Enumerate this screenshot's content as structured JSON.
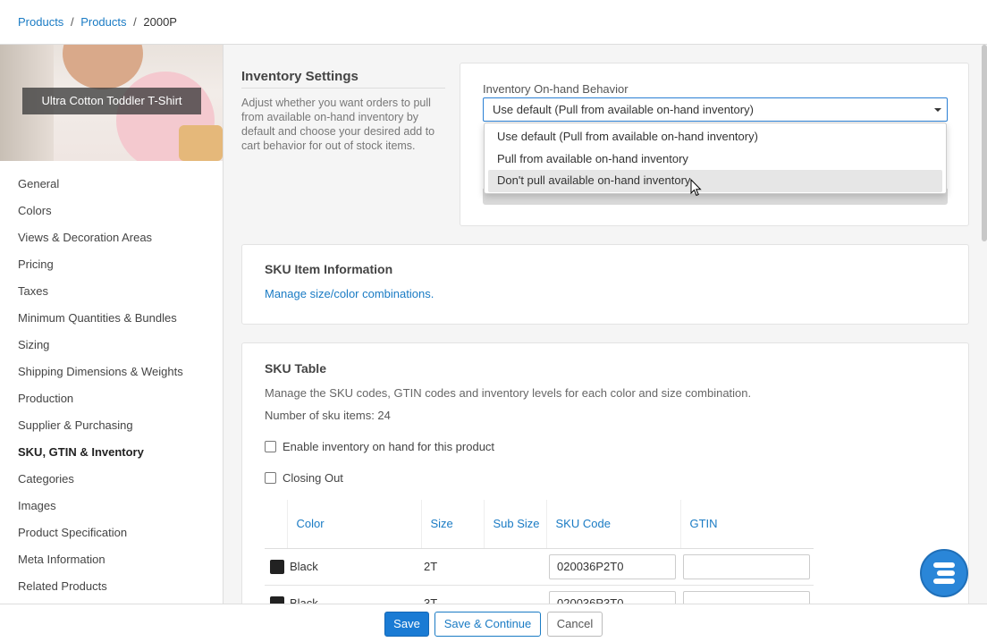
{
  "breadcrumb": {
    "items": [
      "Products",
      "Products"
    ],
    "separator": "/",
    "current": "2000P"
  },
  "sidebar": {
    "product_name": "Ultra Cotton Toddler T-Shirt",
    "items": [
      {
        "label": "General"
      },
      {
        "label": "Colors"
      },
      {
        "label": "Views & Decoration Areas"
      },
      {
        "label": "Pricing"
      },
      {
        "label": "Taxes"
      },
      {
        "label": "Minimum Quantities & Bundles"
      },
      {
        "label": "Sizing"
      },
      {
        "label": "Shipping Dimensions & Weights"
      },
      {
        "label": "Production"
      },
      {
        "label": "Supplier & Purchasing"
      },
      {
        "label": "SKU, GTIN & Inventory",
        "active": true
      },
      {
        "label": "Categories"
      },
      {
        "label": "Images"
      },
      {
        "label": "Product Specification"
      },
      {
        "label": "Meta Information"
      },
      {
        "label": "Related Products"
      }
    ]
  },
  "inventory": {
    "title": "Inventory Settings",
    "description": "Adjust whether you want orders to pull from available on-hand inventory by default and choose your desired add to cart behavior for out of stock items.",
    "field_label": "Inventory On-hand Behavior",
    "selected": "Use default (Pull from available on-hand inventory)",
    "options": [
      "Use default (Pull from available on-hand inventory)",
      "Pull from available on-hand inventory",
      "Don't pull available on-hand inventory"
    ],
    "hovered_option_index": 2
  },
  "sku_info": {
    "title": "SKU Item Information",
    "link_text": "Manage size/color combinations."
  },
  "sku_table": {
    "title": "SKU Table",
    "description": "Manage the SKU codes, GTIN codes and inventory levels for each color and size combination.",
    "count_text": "Number of sku items: 24",
    "checkbox_inventory": "Enable inventory on hand for this product",
    "checkbox_closing": "Closing Out",
    "columns": [
      "Color",
      "Size",
      "Sub Size",
      "SKU Code",
      "GTIN"
    ],
    "rows": [
      {
        "color": "Black",
        "size": "2T",
        "sub_size": "",
        "sku": "020036P2T0",
        "gtin": ""
      },
      {
        "color": "Black",
        "size": "3T",
        "sub_size": "",
        "sku": "020036P3T0",
        "gtin": ""
      }
    ]
  },
  "footer": {
    "save": "Save",
    "save_continue": "Save & Continue",
    "cancel": "Cancel"
  },
  "colors": {
    "accent": "#1a7bc4",
    "primary_button": "#1a7bd4",
    "swatch_black": "#222222"
  }
}
